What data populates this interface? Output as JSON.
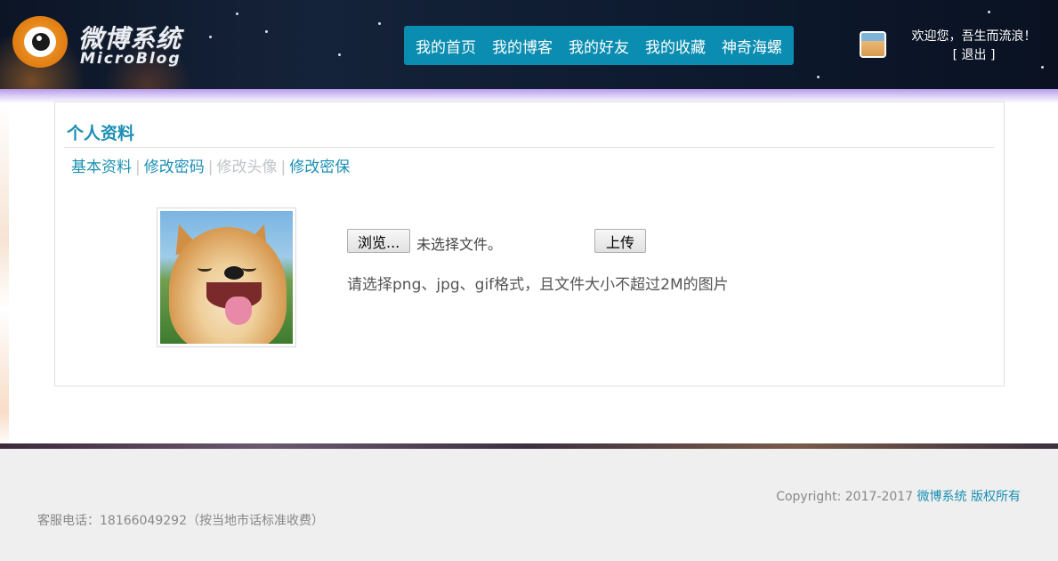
{
  "header": {
    "logo_title": "微博系统",
    "logo_subtitle": "MicroBlog",
    "nav": [
      "我的首页",
      "我的博客",
      "我的好友",
      "我的收藏",
      "神奇海螺"
    ],
    "welcome": "欢迎您，吾生而流浪！",
    "logout": "[ 退出 ]"
  },
  "panel": {
    "title": "个人资料",
    "tabs": [
      "基本资料",
      "修改密码",
      "修改头像",
      "修改密保"
    ],
    "active_tab": "修改头像",
    "browse_label": "浏览...",
    "file_status": "未选择文件。",
    "upload_label": "上传",
    "hint": "请选择png、jpg、gif格式，且文件大小不超过2M的图片"
  },
  "footer": {
    "copyright_prefix": "Copyright: 2017-2017",
    "copyright_brand": "微博系统 版权所有",
    "phone": "客服电话：18166049292（按当地市话标准收费）"
  },
  "colors": {
    "accent": "#1a8fb3",
    "nav_bg": "#0a8db0"
  }
}
